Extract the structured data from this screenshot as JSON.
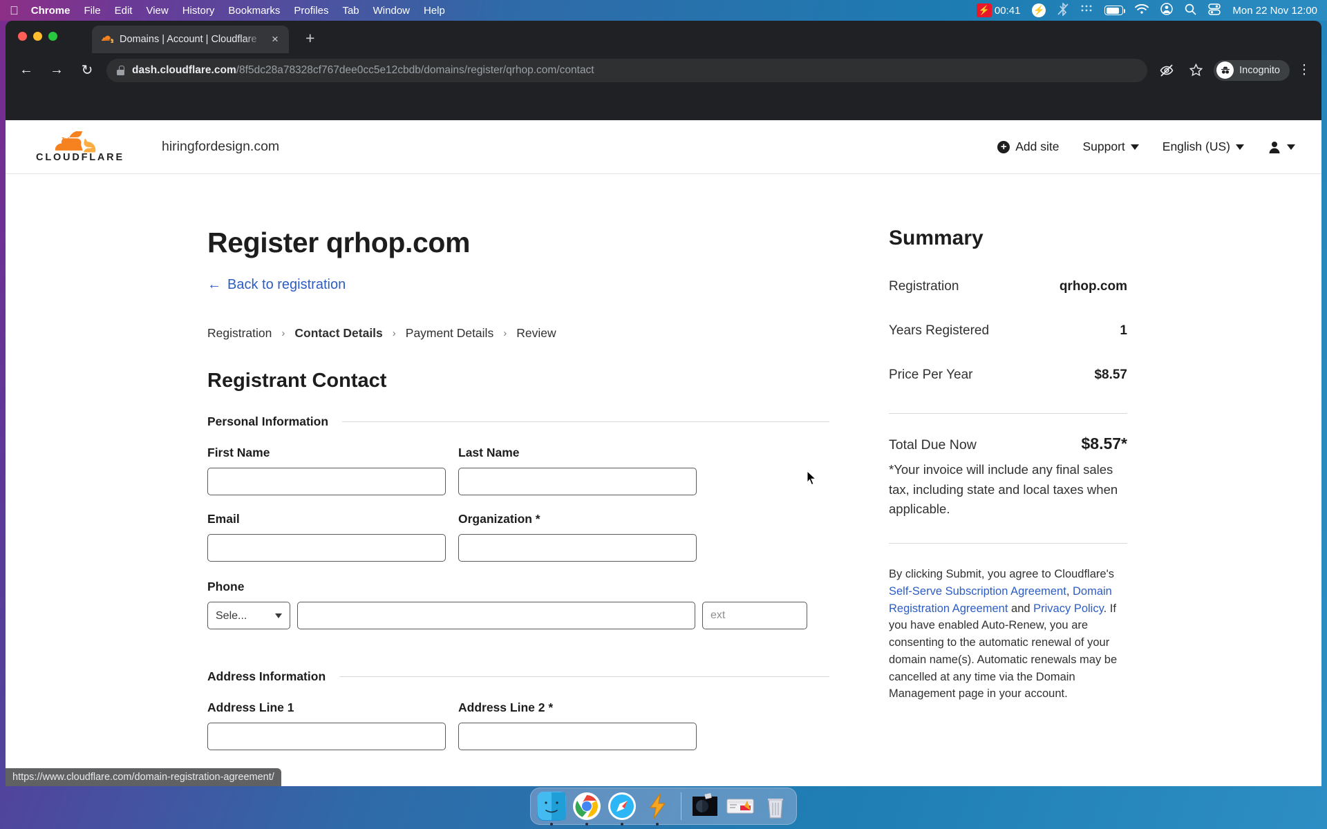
{
  "menubar": {
    "apple": "apple-logo",
    "items": [
      "Chrome",
      "File",
      "Edit",
      "View",
      "History",
      "Bookmarks",
      "Profiles",
      "Tab",
      "Window",
      "Help"
    ],
    "recording_time": "00:41",
    "clock": "Mon 22 Nov  12:00"
  },
  "browser": {
    "tab_title": "Domains | Account | Cloudflare",
    "new_tab_label": "+",
    "close_label": "×",
    "url_host": "dash.cloudflare.com",
    "url_path": "/8f5dc28a78328cf767dee0cc5e12cbdb/domains/register/qrhop.com/contact",
    "profile_label": "Incognito",
    "status_url": "https://www.cloudflare.com/domain-registration-agreement/"
  },
  "cf_header": {
    "brand": "CLOUDFLARE",
    "account": "hiringfordesign.com",
    "add_site": "Add site",
    "support": "Support",
    "language": "English (US)"
  },
  "main": {
    "page_title": "Register qrhop.com",
    "back_link": "Back to registration",
    "breadcrumbs": [
      {
        "label": "Registration",
        "current": false
      },
      {
        "label": "Contact Details",
        "current": true
      },
      {
        "label": "Payment Details",
        "current": false
      },
      {
        "label": "Review",
        "current": false
      }
    ],
    "section_title": "Registrant Contact",
    "personal_section": "Personal Information",
    "address_section": "Address Information",
    "fields": {
      "first_name": {
        "label": "First Name",
        "value": "",
        "placeholder": ""
      },
      "last_name": {
        "label": "Last Name",
        "value": "",
        "placeholder": ""
      },
      "email": {
        "label": "Email",
        "value": "",
        "placeholder": ""
      },
      "organization": {
        "label": "Organization *",
        "value": "",
        "placeholder": ""
      },
      "phone": {
        "label": "Phone",
        "country_value": "Sele...",
        "number_value": "",
        "ext_placeholder": "ext"
      },
      "address1": {
        "label": "Address Line 1",
        "value": "",
        "placeholder": ""
      },
      "address2": {
        "label": "Address Line 2 *",
        "value": "",
        "placeholder": ""
      }
    }
  },
  "summary": {
    "title": "Summary",
    "rows": [
      {
        "label": "Registration",
        "value": "qrhop.com"
      },
      {
        "label": "Years Registered",
        "value": "1"
      },
      {
        "label": "Price Per Year",
        "value": "$8.57"
      }
    ],
    "total_label": "Total Due Now",
    "total_value": "$8.57*",
    "tax_note": "*Your invoice will include any final sales tax, including state and local taxes when applicable.",
    "legal_prefix": "By clicking Submit, you agree to Cloudflare's ",
    "legal_link1": "Self-Serve Subscription Agreement",
    "legal_mid1": ", ",
    "legal_link2": "Domain Registration Agreement",
    "legal_mid2": " and ",
    "legal_link3": "Privacy Policy",
    "legal_suffix": ". If you have enabled Auto-Renew, you are consenting to the automatic renewal of your domain name(s). Automatic renewals may be cancelled at any time via the Domain Management page in your account."
  },
  "colors": {
    "accent_link": "#2c5cc5",
    "cloudflare_orange": "#f6821f",
    "cloudflare_orange_dark": "#e8662a"
  },
  "dock": {
    "items": [
      "finder-icon",
      "chrome-icon",
      "safari-icon",
      "lightning-icon",
      "screenshot-icon",
      "terminal-icon",
      "trash-icon"
    ]
  }
}
